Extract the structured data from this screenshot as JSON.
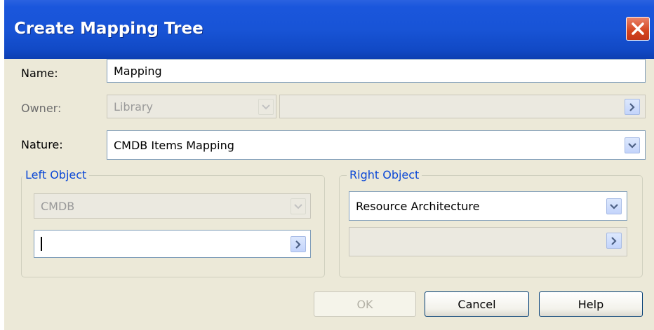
{
  "dialog": {
    "title": "Create Mapping Tree",
    "close_icon": "close-x-icon"
  },
  "form": {
    "name_label": "Name:",
    "name_value": "Mapping",
    "owner_label": "Owner:",
    "owner_value": "Library",
    "owner_path_value": "",
    "nature_label": "Nature:",
    "nature_value": "CMDB Items Mapping"
  },
  "left_object": {
    "legend": "Left Object",
    "type_value": "CMDB",
    "object_value": ""
  },
  "right_object": {
    "legend": "Right Object",
    "type_value": "Resource Architecture",
    "object_value": ""
  },
  "buttons": {
    "ok": "OK",
    "cancel": "Cancel",
    "help": "Help"
  },
  "colors": {
    "title_bar": "#1854d6",
    "legend_text": "#0b48d6",
    "dialog_bg": "#ece9d8",
    "close_button": "#d4451f"
  }
}
